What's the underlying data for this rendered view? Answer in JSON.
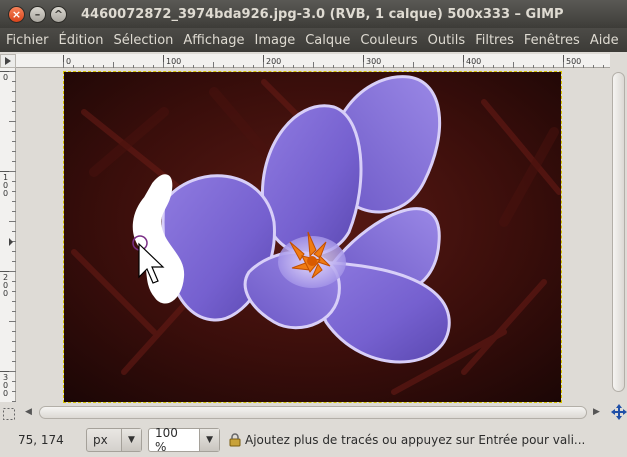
{
  "window": {
    "title": "4460072872_3974bda926.jpg-3.0 (RVB, 1 calque) 500x333 – GIMP",
    "buttons": {
      "close": "×",
      "minimize": "–",
      "maximize": "^"
    }
  },
  "menu": {
    "items": [
      "Fichier",
      "Édition",
      "Sélection",
      "Affichage",
      "Image",
      "Calque",
      "Couleurs",
      "Outils",
      "Filtres",
      "Fenêtres",
      "Aide"
    ]
  },
  "rulers": {
    "horizontal_labels": [
      "0",
      "100",
      "200",
      "300",
      "400",
      "500"
    ],
    "vertical_labels": [
      "0",
      "100",
      "200",
      "300"
    ]
  },
  "status": {
    "coordinates": "75, 174",
    "unit": "px",
    "zoom": "100 %",
    "message": "Ajoutez plus de tracés ou appuyez sur Entrée pour vali..."
  },
  "icons": {
    "ruler_corner": "triangle-right-icon",
    "navigate": "navigate-cross-icon",
    "quickmask": "quickmask-icon",
    "status": "lock-icon"
  }
}
